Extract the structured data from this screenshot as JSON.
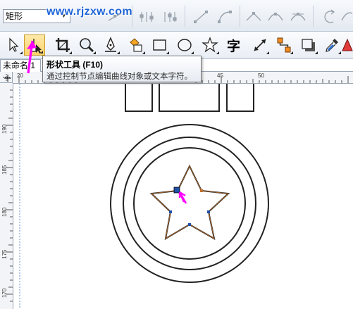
{
  "property_bar": {
    "shape_select_value": "矩形",
    "watermark_text": "www.rjzxw.com"
  },
  "tooltip": {
    "title": "形状工具 (F10)",
    "description": "通过控制节点编辑曲线对象或文本字符。"
  },
  "document": {
    "tab_label": "未命名 1"
  },
  "rulers": {
    "horizontal_ticks": [
      "20",
      "45",
      "50"
    ],
    "vertical_ticks": [
      "190",
      "185",
      "180",
      "175",
      "170"
    ]
  },
  "toolbox": {
    "text_tool_glyph": "字"
  },
  "colors": {
    "accent_arrow": "#ff00ff",
    "selected_node": "#1f4fa8",
    "star_path": "#c0702a",
    "watermark": "#1e64d6"
  },
  "icons": [
    "pick-tool-icon",
    "shape-tool-icon",
    "crop-tool-icon",
    "zoom-tool-icon",
    "freehand-tool-icon",
    "smart-fill-icon",
    "rectangle-tool-icon",
    "ellipse-tool-icon",
    "polygon-tool-icon",
    "text-tool-icon",
    "dimension-tool-icon",
    "connector-tool-icon",
    "drop-shadow-icon",
    "eyedropper-icon",
    "fill-icon"
  ]
}
